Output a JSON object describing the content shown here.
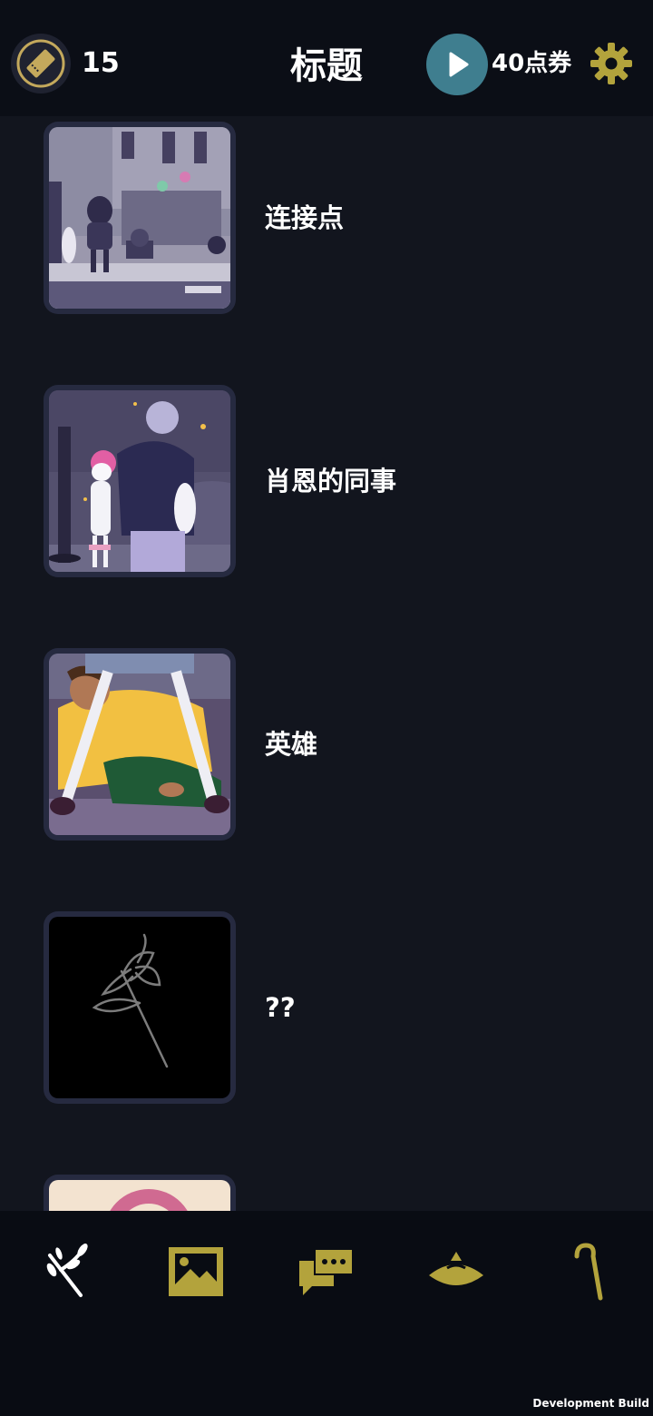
{
  "header": {
    "ticket_count": "15",
    "title": "标题",
    "points_label": "40点券"
  },
  "episodes": [
    {
      "label": "连接点"
    },
    {
      "label": "肖恩的同事"
    },
    {
      "label": "英雄"
    },
    {
      "label": "??"
    }
  ],
  "footer": {
    "dev_build": "Development Build"
  },
  "icons": {
    "ticket": "ticket-icon",
    "play": "play-icon",
    "settings": "gear-icon",
    "nav": [
      "branch-icon",
      "gallery-icon",
      "chat-icon",
      "hat-icon",
      "cane-icon"
    ]
  },
  "colors": {
    "accent_gold": "#b3a33c",
    "play_teal": "#3f7e8f",
    "background": "#12151e",
    "topbar": "#0b0e16"
  }
}
